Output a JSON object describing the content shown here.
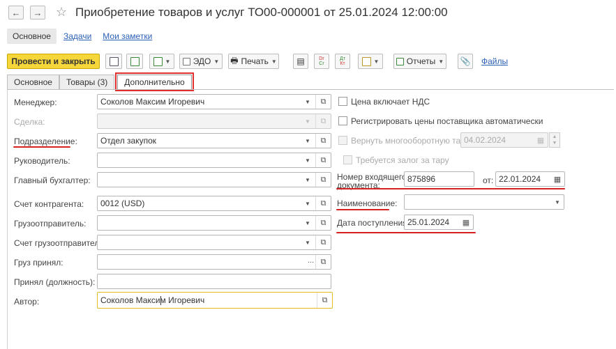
{
  "window": {
    "title": "Приобретение товаров и услуг ТО00-000001 от 25.01.2024 12:00:00"
  },
  "subnav": {
    "main": "Основное",
    "tasks": "Задачи",
    "notes": "Мои заметки"
  },
  "toolbar": {
    "post_close": "Провести и закрыть",
    "edo": "ЭДО",
    "print": "Печать",
    "dt": "Dr",
    "kt": "Cr",
    "dtkt_top": "Дт",
    "dtkt_bottom": "Кт",
    "reports": "Отчеты",
    "files": "Файлы"
  },
  "tabs": [
    {
      "label": "Основное"
    },
    {
      "label": "Товары (3)"
    },
    {
      "label": "Дополнительно"
    }
  ],
  "form": {
    "manager_label": "Менеджер:",
    "manager_value": "Соколов Максим Игоревич",
    "deal_label": "Сделка:",
    "department_label": "Подразделение:",
    "department_value": "Отдел закупок",
    "head_label": "Руководитель:",
    "accountant_label": "Главный бухгалтер:",
    "contractor_account_label": "Счет контрагента:",
    "contractor_account_value": "0012 (USD)",
    "shipper_label": "Грузоотправитель:",
    "shipper_account_label": "Счет грузоотправителя:",
    "cargo_received_label": "Груз принял:",
    "received_position_label": "Принял (должность):",
    "author_label": "Автор:",
    "author_value": "Соколов Максим Игоревич"
  },
  "right": {
    "price_vat": "Цена включает НДС",
    "register_prices": "Регистрировать цены поставщика автоматически",
    "return_tare": "Вернуть многооборотную тару:",
    "return_date": "04.02.2024",
    "deposit": "Требуется залог за тару",
    "incoming_label_1": "Номер входящего",
    "incoming_label_2": "документа:",
    "incoming_number": "875896",
    "from_label": "от:",
    "from_date": "22.01.2024",
    "name_label": "Наименование:",
    "receipt_date_label": "Дата поступления:",
    "receipt_date": "25.01.2024"
  },
  "colors": {
    "accent_yellow": "#f5d63b",
    "link_blue": "#2b60b6",
    "highlight_red": "#d42020"
  }
}
